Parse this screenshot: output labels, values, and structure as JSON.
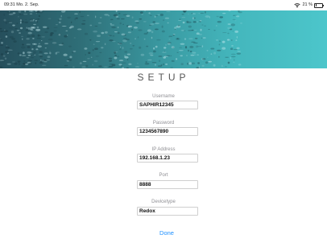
{
  "status_bar": {
    "time_date": "09:31  Mo. 2. Sep.",
    "battery_text": "21 %",
    "battery_level": 0.21,
    "icons": [
      "wifi-icon",
      "battery-icon"
    ]
  },
  "setup": {
    "title": "SETUP",
    "fields": [
      {
        "label": "Username",
        "value": "SAPHIR12345"
      },
      {
        "label": "Password",
        "value": "1234567890"
      },
      {
        "label": "IP Address",
        "value": "192.168.1.23"
      },
      {
        "label": "Port",
        "value": "8888"
      },
      {
        "label": "Devicetype",
        "value": "Redox"
      }
    ],
    "done_label": "Done"
  },
  "colors": {
    "accent": "#1e90ff",
    "banner_start": "#264f5c",
    "banner_end": "#4cc6cb"
  }
}
